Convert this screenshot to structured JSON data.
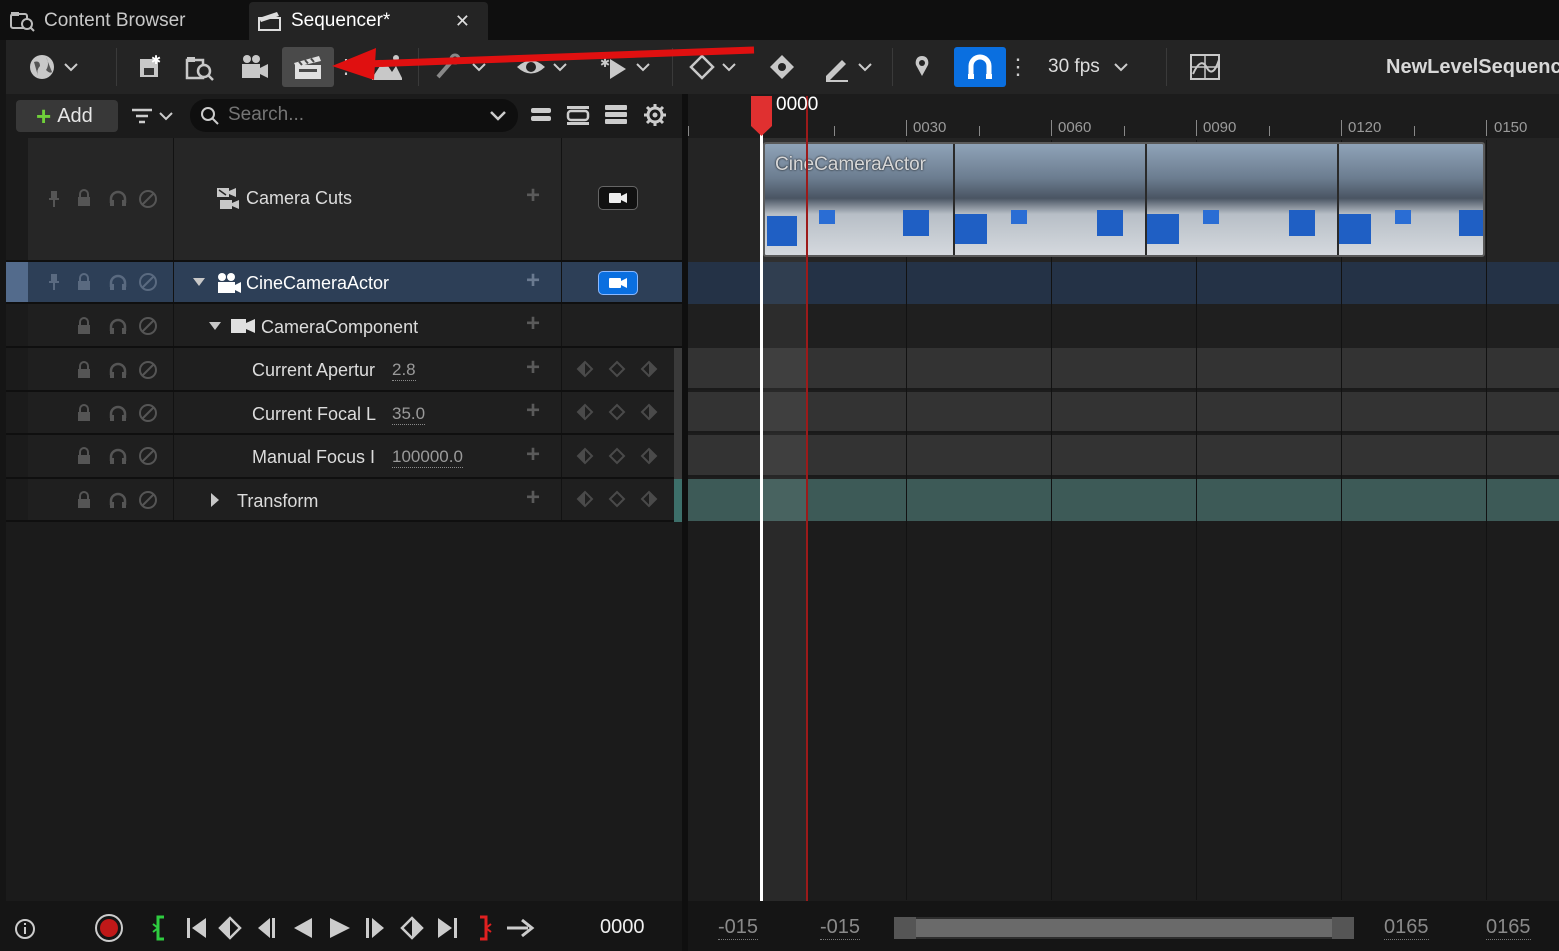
{
  "tabs": [
    {
      "label": "Content Browser",
      "icon": "content-browser-icon"
    },
    {
      "label": "Sequencer*",
      "icon": "sequencer-icon"
    }
  ],
  "toolbar": {
    "fps_label": "30 fps",
    "sequence_name": "NewLevelSequence",
    "snap_color": "#0a6fe0"
  },
  "outliner": {
    "add_label": "Add",
    "search_placeholder": "Search...",
    "rows": [
      {
        "label": "Camera Cuts"
      },
      {
        "label": "CineCameraActor"
      },
      {
        "label": "CameraComponent"
      },
      {
        "label": "Current Apertur",
        "value": "2.8"
      },
      {
        "label": "Current Focal L",
        "value": "35.0"
      },
      {
        "label": "Manual Focus I",
        "value": "100000.0"
      },
      {
        "label": "Transform"
      }
    ]
  },
  "timeline": {
    "playhead_label": "0000",
    "ticks": [
      "0030",
      "0060",
      "0090",
      "0120",
      "0150"
    ],
    "clip_label": "CineCameraActor"
  },
  "bottom": {
    "current_frame": "0000",
    "view_start": "-015",
    "working_start": "-015",
    "view_end": "0165",
    "working_end": "0165"
  },
  "colors": {
    "playhead": "#e03030",
    "selected_row": "#2d3f57",
    "transform_track": "#3d5a57",
    "annotation_arrow": "#e01010"
  }
}
